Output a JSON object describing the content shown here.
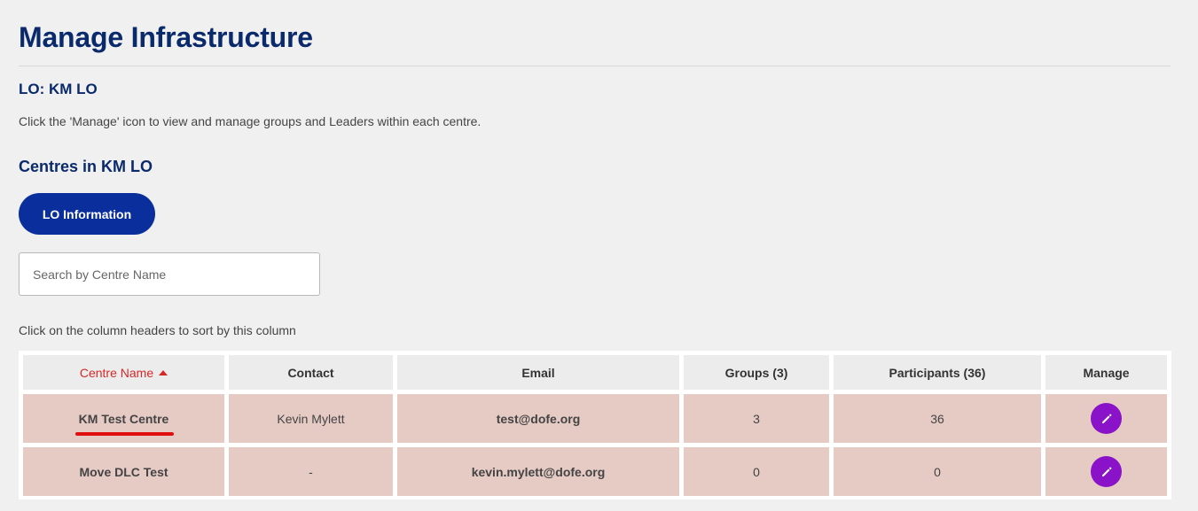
{
  "page": {
    "title": "Manage Infrastructure",
    "lo_heading": "LO: KM LO",
    "instructions": "Click the 'Manage' icon to view and manage groups and Leaders within each centre.",
    "centres_heading": "Centres in KM LO",
    "lo_button_label": "LO Information",
    "sort_hint": "Click on the column headers to sort by this column"
  },
  "search": {
    "placeholder": "Search by Centre Name",
    "value": ""
  },
  "table": {
    "headers": {
      "centre_name": "Centre Name",
      "contact": "Contact",
      "email": "Email",
      "groups": "Groups (3)",
      "participants": "Participants (36)",
      "manage": "Manage"
    },
    "sort": {
      "column": "Centre Name",
      "direction": "ascending"
    },
    "rows": [
      {
        "centre_name": "KM Test Centre",
        "contact": "Kevin Mylett",
        "email": "test@dofe.org",
        "groups": "3",
        "participants": "36",
        "manage_icon": "pencil-icon"
      },
      {
        "centre_name": "Move DLC Test",
        "contact": "-",
        "email": "kevin.mylett@dofe.org",
        "groups": "0",
        "participants": "0",
        "manage_icon": "pencil-icon"
      }
    ]
  },
  "colors": {
    "heading": "#0a2a6b",
    "primary_button": "#0a2f9c",
    "sorted_header": "#d62828",
    "row_background": "#e6cac4",
    "manage_button": "#8a12c8",
    "annotation_underline": "#e01010"
  }
}
